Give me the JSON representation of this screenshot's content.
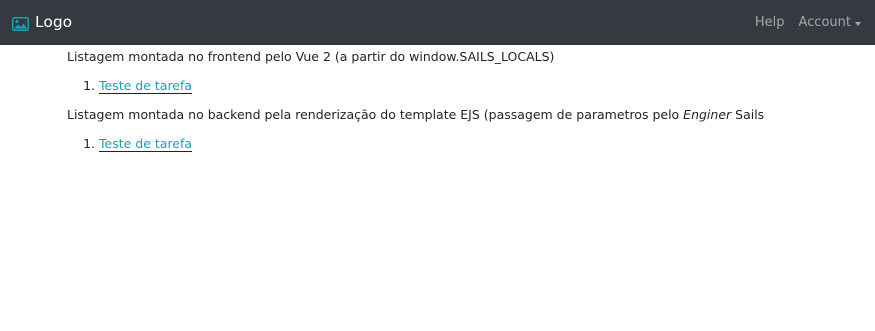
{
  "navbar": {
    "brand_label": "Logo",
    "brand_icon": "image-icon",
    "brand_color": "#17a2b8",
    "background": "#343a40",
    "help_label": "Help",
    "account_label": "Account"
  },
  "main": {
    "frontend_heading": "Listagem montada no frontend pelo Vue 2 (a partir do window.SAILS_LOCALS)",
    "frontend_tasks": [
      "Teste de tarefa"
    ],
    "backend_heading_prefix": "Listagem montada no backend pela renderização do template EJS (passagem de parametros pelo ",
    "backend_heading_emphasis": "Enginer",
    "backend_heading_suffix": " Sails",
    "backend_tasks": [
      "Teste de tarefa"
    ],
    "link_color": "#17a2b8"
  }
}
